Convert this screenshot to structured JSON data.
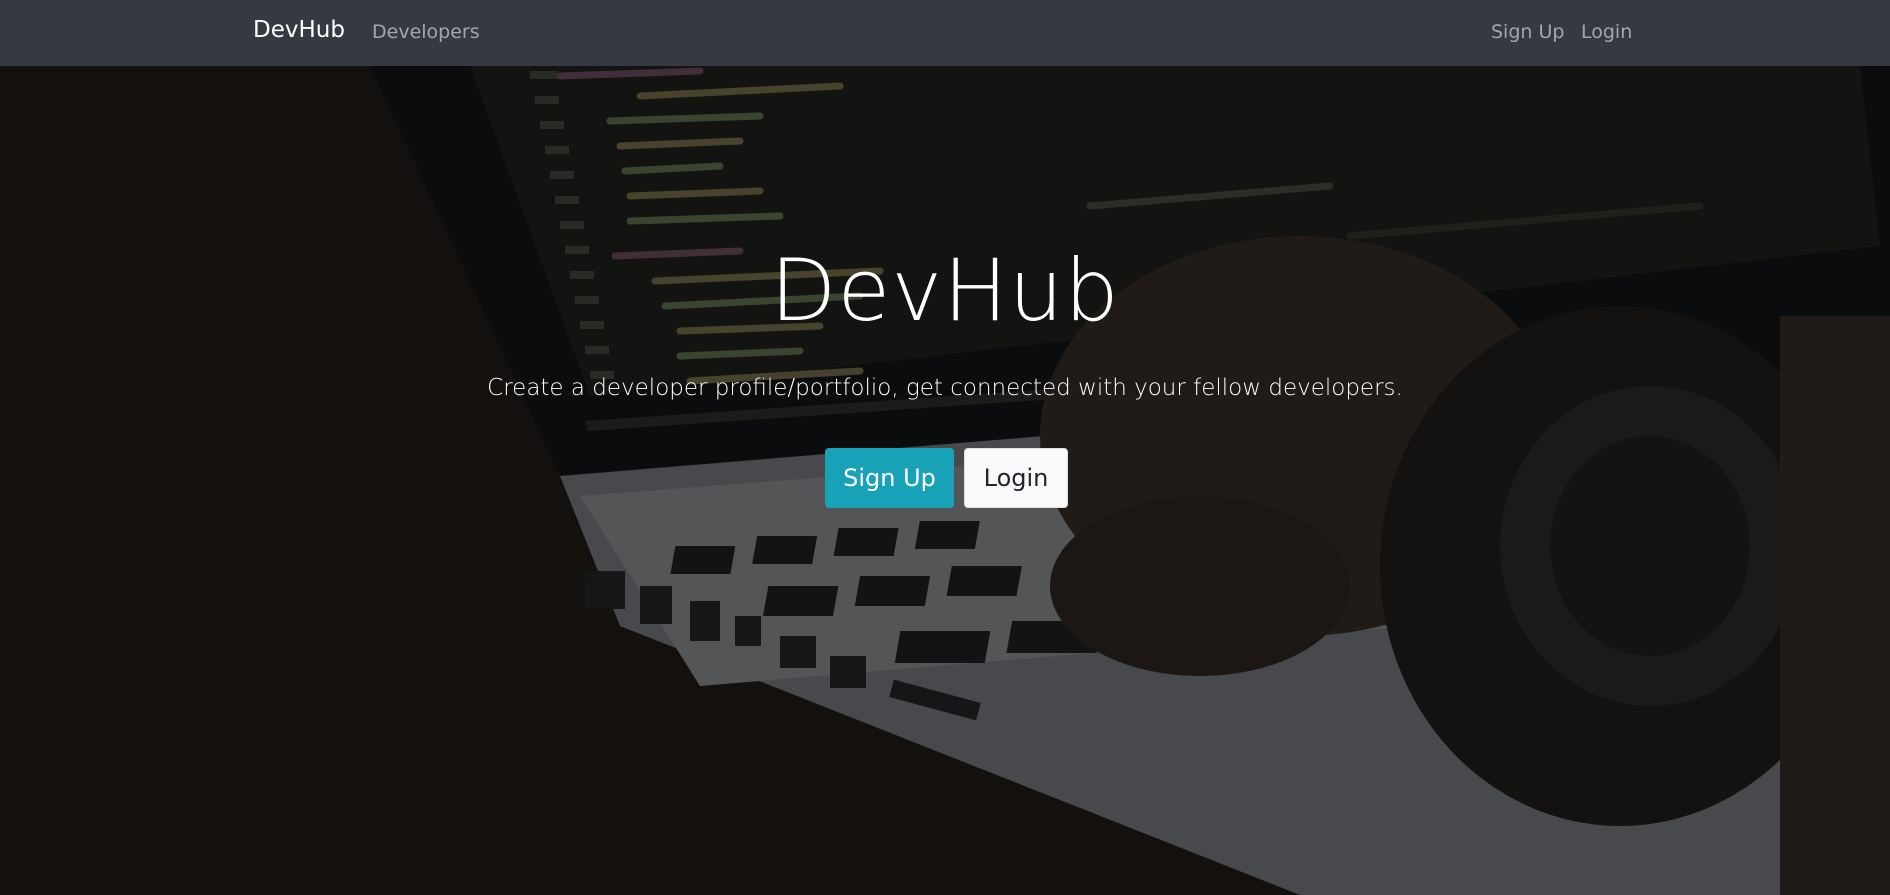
{
  "navbar": {
    "brand": "DevHub",
    "links": {
      "developers": "Developers",
      "signup": "Sign Up",
      "login": "Login"
    }
  },
  "hero": {
    "title": "DevHub",
    "lead": "Create a developer profile/portfolio, get connected with your fellow developers.",
    "buttons": {
      "signup": "Sign Up",
      "login": "Login"
    },
    "background_description": "laptop-typing-photo"
  },
  "colors": {
    "navbar_bg": "#343a40",
    "primary_button": "#17a2b8",
    "light_button": "#f8f9fa"
  }
}
